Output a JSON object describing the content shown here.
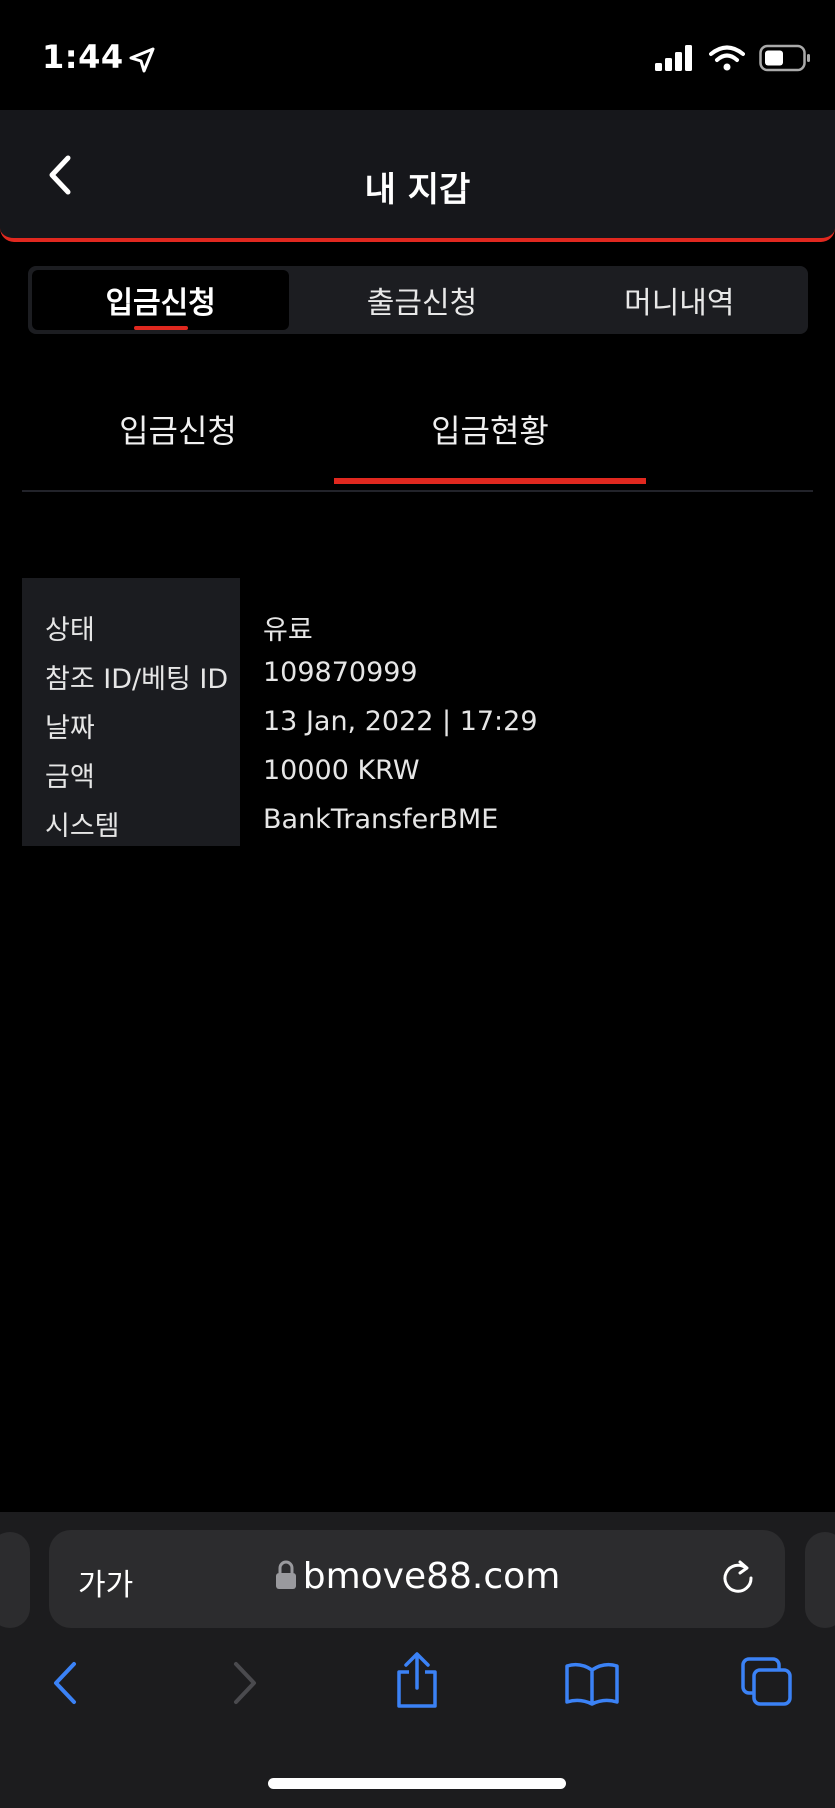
{
  "status_bar": {
    "time": "1:44"
  },
  "header": {
    "title": "내 지갑"
  },
  "main_tabs": [
    {
      "label": "입금신청"
    },
    {
      "label": "출금신청"
    },
    {
      "label": "머니내역"
    }
  ],
  "sub_tabs": [
    {
      "label": "입금신청"
    },
    {
      "label": "입금현황"
    }
  ],
  "deposit_status": {
    "rows": [
      {
        "label": "상태",
        "value": "유료"
      },
      {
        "label": "참조 ID/베팅 ID",
        "value": "109870999"
      },
      {
        "label": "날짜",
        "value": "13 Jan, 2022 | 17:29"
      },
      {
        "label": "금액",
        "value": "10000 KRW"
      },
      {
        "label": "시스템",
        "value": "BankTransferBME"
      }
    ]
  },
  "browser": {
    "text_size_label": "가가",
    "url": "bmove88.com"
  },
  "colors": {
    "accent": "#e0281f",
    "ios_blue": "#3b82f6"
  }
}
